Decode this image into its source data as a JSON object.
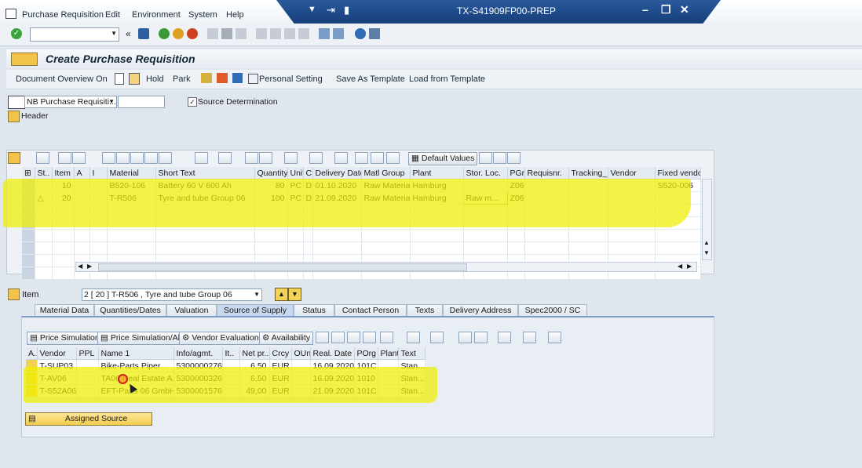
{
  "menu": [
    "Purchase Requisition",
    "Edit",
    "Environment",
    "System",
    "Help"
  ],
  "window": {
    "title": "TX-S41909FP00-PREP"
  },
  "page_title": "Create Purchase Requisition",
  "app_toolbar": {
    "doc_overview": "Document Overview On",
    "hold": "Hold",
    "park": "Park",
    "personal_setting": "Personal Setting",
    "save_template": "Save As Template",
    "load_template": "Load from Template"
  },
  "header_bar": {
    "doc_type": "NB Purchase Requisiti...",
    "source_determination": "Source Determination",
    "header_label": "Header"
  },
  "items_grid": {
    "default_values": "Default Values",
    "columns": [
      "St..",
      "Item",
      "A",
      "I",
      "Material",
      "Short Text",
      "Quantity",
      "Unit",
      "C",
      "Delivery Date",
      "Matl Group",
      "Plant",
      "Stor. Loc.",
      "PGr",
      "Requisnr.",
      "Tracking_",
      "Vendor",
      "Fixed vendo"
    ],
    "rows": [
      [
        "",
        "10",
        "",
        "",
        "B520-106",
        "Battery 60 V 600 Ah",
        "80",
        "PC",
        "D",
        "01.10.2020",
        "Raw Materials",
        "Hamburg",
        "",
        "Z06",
        "",
        "",
        "",
        "S520-006"
      ],
      [
        "△",
        "20",
        "",
        "",
        "T-R506",
        "Tyre and tube Group 06",
        "100",
        "PC",
        "D",
        "21.09.2020",
        "Raw Materials",
        "Hamburg",
        "Raw m...",
        "Z06",
        "",
        "",
        "",
        ""
      ]
    ]
  },
  "item_detail": {
    "label": "Item",
    "selected": "2 [ 20 ] T-R506 , Tyre and tube Group 06"
  },
  "tabs": [
    "Material Data",
    "Quantities/Dates",
    "Valuation",
    "Source of Supply",
    "Status",
    "Contact Person",
    "Texts",
    "Delivery Address",
    "Spec2000 / SC"
  ],
  "supply": {
    "buttons": [
      "Price Simulation",
      "Price Simulation/All",
      "Vendor Evaluation",
      "Availability"
    ],
    "columns": [
      "A..",
      "Vendor",
      "PPL",
      "Name 1",
      "Info/agmt.",
      "It..",
      "Net pr...",
      "Crcy",
      "OUn",
      "Real. Date",
      "POrg",
      "Plant",
      "Text"
    ],
    "rows": [
      [
        "",
        "T-SUP03",
        "",
        "Bike-Parts Piper",
        "5300000276",
        "",
        "6,50",
        "EUR",
        "",
        "16.09.2020",
        "101C",
        "",
        "Stan..."
      ],
      [
        "",
        "T-AV06",
        "",
        "TA06 Real Estate A...",
        "5300000326",
        "",
        "6,50",
        "EUR",
        "",
        "16.09.2020",
        "1010",
        "",
        "Stan..."
      ],
      [
        "",
        "T-S52A06",
        "",
        "EFT-Parts 06 GmbH",
        "5300001576",
        "",
        "49,00",
        "EUR",
        "",
        "21.09.2020",
        "101C",
        "",
        "Stan..."
      ]
    ],
    "assigned_source": "Assigned Source"
  },
  "colors": {
    "highlight": "#eeee00",
    "title_band": "#1f4f8e",
    "accent": "#2f6cb5"
  }
}
